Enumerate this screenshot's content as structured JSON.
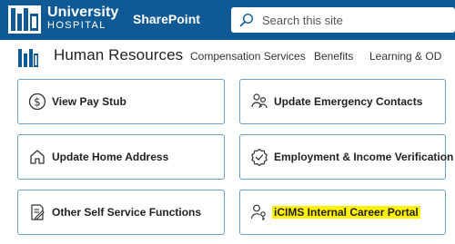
{
  "suitebar": {
    "logo_line1": "University",
    "logo_line2": "HOSPITAL",
    "app_name": "SharePoint",
    "search_placeholder": "Search this site",
    "background": "#0f5a94"
  },
  "site": {
    "title": "Human Resources",
    "nav": [
      "Compensation Services",
      "Benefits",
      "Learning & OD"
    ]
  },
  "cards": [
    {
      "label": "View Pay Stub",
      "icon": "dollar-circle-icon"
    },
    {
      "label": "Update Emergency Contacts",
      "icon": "people-icon"
    },
    {
      "label": "Update Home Address",
      "icon": "home-icon"
    },
    {
      "label": "Employment & Income Verification",
      "icon": "verified-badge-icon"
    },
    {
      "label": "Other Self Service Functions",
      "icon": "form-edit-icon"
    },
    {
      "label": "iCIMS Internal Career Portal",
      "icon": "person-key-icon",
      "highlighted": true
    }
  ],
  "colors": {
    "card_border": "#6f9fc6",
    "highlight": "#fff200",
    "brand": "#0f5a94"
  }
}
